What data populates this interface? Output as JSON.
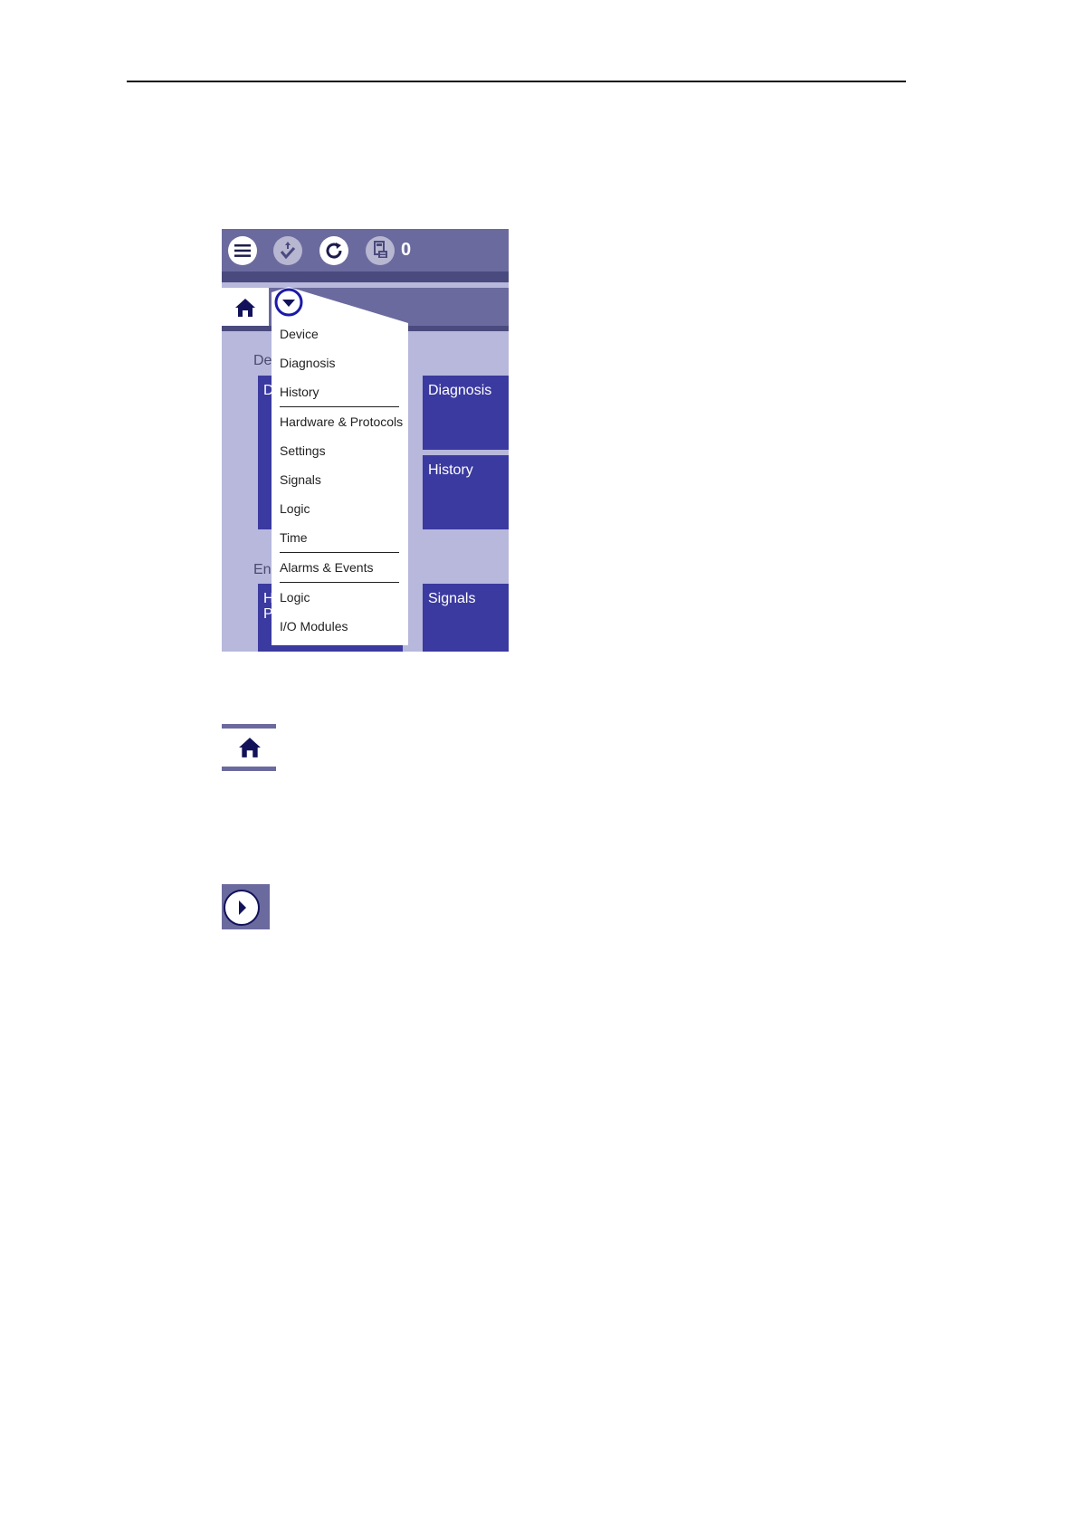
{
  "toolbar": {
    "menu_icon": "hamburger-menu-icon",
    "sync_icon": "upload-check-icon",
    "refresh_icon": "refresh-icon",
    "alarm_icon": "alarm-list-icon",
    "alarm_count": "0"
  },
  "navbar": {
    "home_icon": "home-icon",
    "dropdown_icon": "chevron-down-circle-icon"
  },
  "background": {
    "section_1_partial": "De",
    "section_2_partial": "En",
    "tile_left_1_partial": "D",
    "tile_left_2_partial_line1": "H",
    "tile_left_2_partial_line2": "P",
    "tiles": [
      "Diagnosis",
      "History",
      "Signals"
    ]
  },
  "menu": {
    "items": [
      {
        "label": "Device"
      },
      {
        "label": "Diagnosis"
      },
      {
        "label": "History",
        "separator_after": true
      },
      {
        "label": "Hardware & Protocols"
      },
      {
        "label": "Settings"
      },
      {
        "label": "Signals"
      },
      {
        "label": "Logic"
      },
      {
        "label": "Time",
        "separator_after": true
      },
      {
        "label": "Alarms & Events",
        "separator_after": true
      },
      {
        "label": "Logic"
      },
      {
        "label": "I/O Modules"
      }
    ]
  },
  "legend": {
    "home_icon": "home-icon",
    "next_icon": "chevron-right-circle-icon"
  },
  "colors": {
    "toolbar": "#6b6a9e",
    "tile": "#3b3aa0",
    "panel_bg": "#b7b8dc",
    "accent": "#1a1aa8"
  }
}
